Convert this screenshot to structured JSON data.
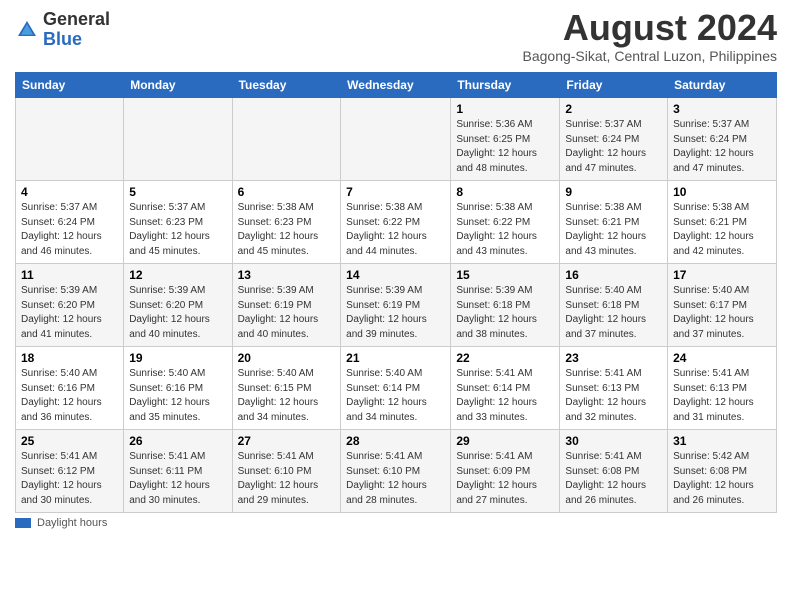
{
  "header": {
    "logo_general": "General",
    "logo_blue": "Blue",
    "month_title": "August 2024",
    "subtitle": "Bagong-Sikat, Central Luzon, Philippines"
  },
  "weekdays": [
    "Sunday",
    "Monday",
    "Tuesday",
    "Wednesday",
    "Thursday",
    "Friday",
    "Saturday"
  ],
  "weeks": [
    [
      {
        "day": "",
        "info": ""
      },
      {
        "day": "",
        "info": ""
      },
      {
        "day": "",
        "info": ""
      },
      {
        "day": "",
        "info": ""
      },
      {
        "day": "1",
        "info": "Sunrise: 5:36 AM\nSunset: 6:25 PM\nDaylight: 12 hours\nand 48 minutes."
      },
      {
        "day": "2",
        "info": "Sunrise: 5:37 AM\nSunset: 6:24 PM\nDaylight: 12 hours\nand 47 minutes."
      },
      {
        "day": "3",
        "info": "Sunrise: 5:37 AM\nSunset: 6:24 PM\nDaylight: 12 hours\nand 47 minutes."
      }
    ],
    [
      {
        "day": "4",
        "info": "Sunrise: 5:37 AM\nSunset: 6:24 PM\nDaylight: 12 hours\nand 46 minutes."
      },
      {
        "day": "5",
        "info": "Sunrise: 5:37 AM\nSunset: 6:23 PM\nDaylight: 12 hours\nand 45 minutes."
      },
      {
        "day": "6",
        "info": "Sunrise: 5:38 AM\nSunset: 6:23 PM\nDaylight: 12 hours\nand 45 minutes."
      },
      {
        "day": "7",
        "info": "Sunrise: 5:38 AM\nSunset: 6:22 PM\nDaylight: 12 hours\nand 44 minutes."
      },
      {
        "day": "8",
        "info": "Sunrise: 5:38 AM\nSunset: 6:22 PM\nDaylight: 12 hours\nand 43 minutes."
      },
      {
        "day": "9",
        "info": "Sunrise: 5:38 AM\nSunset: 6:21 PM\nDaylight: 12 hours\nand 43 minutes."
      },
      {
        "day": "10",
        "info": "Sunrise: 5:38 AM\nSunset: 6:21 PM\nDaylight: 12 hours\nand 42 minutes."
      }
    ],
    [
      {
        "day": "11",
        "info": "Sunrise: 5:39 AM\nSunset: 6:20 PM\nDaylight: 12 hours\nand 41 minutes."
      },
      {
        "day": "12",
        "info": "Sunrise: 5:39 AM\nSunset: 6:20 PM\nDaylight: 12 hours\nand 40 minutes."
      },
      {
        "day": "13",
        "info": "Sunrise: 5:39 AM\nSunset: 6:19 PM\nDaylight: 12 hours\nand 40 minutes."
      },
      {
        "day": "14",
        "info": "Sunrise: 5:39 AM\nSunset: 6:19 PM\nDaylight: 12 hours\nand 39 minutes."
      },
      {
        "day": "15",
        "info": "Sunrise: 5:39 AM\nSunset: 6:18 PM\nDaylight: 12 hours\nand 38 minutes."
      },
      {
        "day": "16",
        "info": "Sunrise: 5:40 AM\nSunset: 6:18 PM\nDaylight: 12 hours\nand 37 minutes."
      },
      {
        "day": "17",
        "info": "Sunrise: 5:40 AM\nSunset: 6:17 PM\nDaylight: 12 hours\nand 37 minutes."
      }
    ],
    [
      {
        "day": "18",
        "info": "Sunrise: 5:40 AM\nSunset: 6:16 PM\nDaylight: 12 hours\nand 36 minutes."
      },
      {
        "day": "19",
        "info": "Sunrise: 5:40 AM\nSunset: 6:16 PM\nDaylight: 12 hours\nand 35 minutes."
      },
      {
        "day": "20",
        "info": "Sunrise: 5:40 AM\nSunset: 6:15 PM\nDaylight: 12 hours\nand 34 minutes."
      },
      {
        "day": "21",
        "info": "Sunrise: 5:40 AM\nSunset: 6:14 PM\nDaylight: 12 hours\nand 34 minutes."
      },
      {
        "day": "22",
        "info": "Sunrise: 5:41 AM\nSunset: 6:14 PM\nDaylight: 12 hours\nand 33 minutes."
      },
      {
        "day": "23",
        "info": "Sunrise: 5:41 AM\nSunset: 6:13 PM\nDaylight: 12 hours\nand 32 minutes."
      },
      {
        "day": "24",
        "info": "Sunrise: 5:41 AM\nSunset: 6:13 PM\nDaylight: 12 hours\nand 31 minutes."
      }
    ],
    [
      {
        "day": "25",
        "info": "Sunrise: 5:41 AM\nSunset: 6:12 PM\nDaylight: 12 hours\nand 30 minutes."
      },
      {
        "day": "26",
        "info": "Sunrise: 5:41 AM\nSunset: 6:11 PM\nDaylight: 12 hours\nand 30 minutes."
      },
      {
        "day": "27",
        "info": "Sunrise: 5:41 AM\nSunset: 6:10 PM\nDaylight: 12 hours\nand 29 minutes."
      },
      {
        "day": "28",
        "info": "Sunrise: 5:41 AM\nSunset: 6:10 PM\nDaylight: 12 hours\nand 28 minutes."
      },
      {
        "day": "29",
        "info": "Sunrise: 5:41 AM\nSunset: 6:09 PM\nDaylight: 12 hours\nand 27 minutes."
      },
      {
        "day": "30",
        "info": "Sunrise: 5:41 AM\nSunset: 6:08 PM\nDaylight: 12 hours\nand 26 minutes."
      },
      {
        "day": "31",
        "info": "Sunrise: 5:42 AM\nSunset: 6:08 PM\nDaylight: 12 hours\nand 26 minutes."
      }
    ]
  ],
  "legend": {
    "daylight_label": "Daylight hours"
  }
}
